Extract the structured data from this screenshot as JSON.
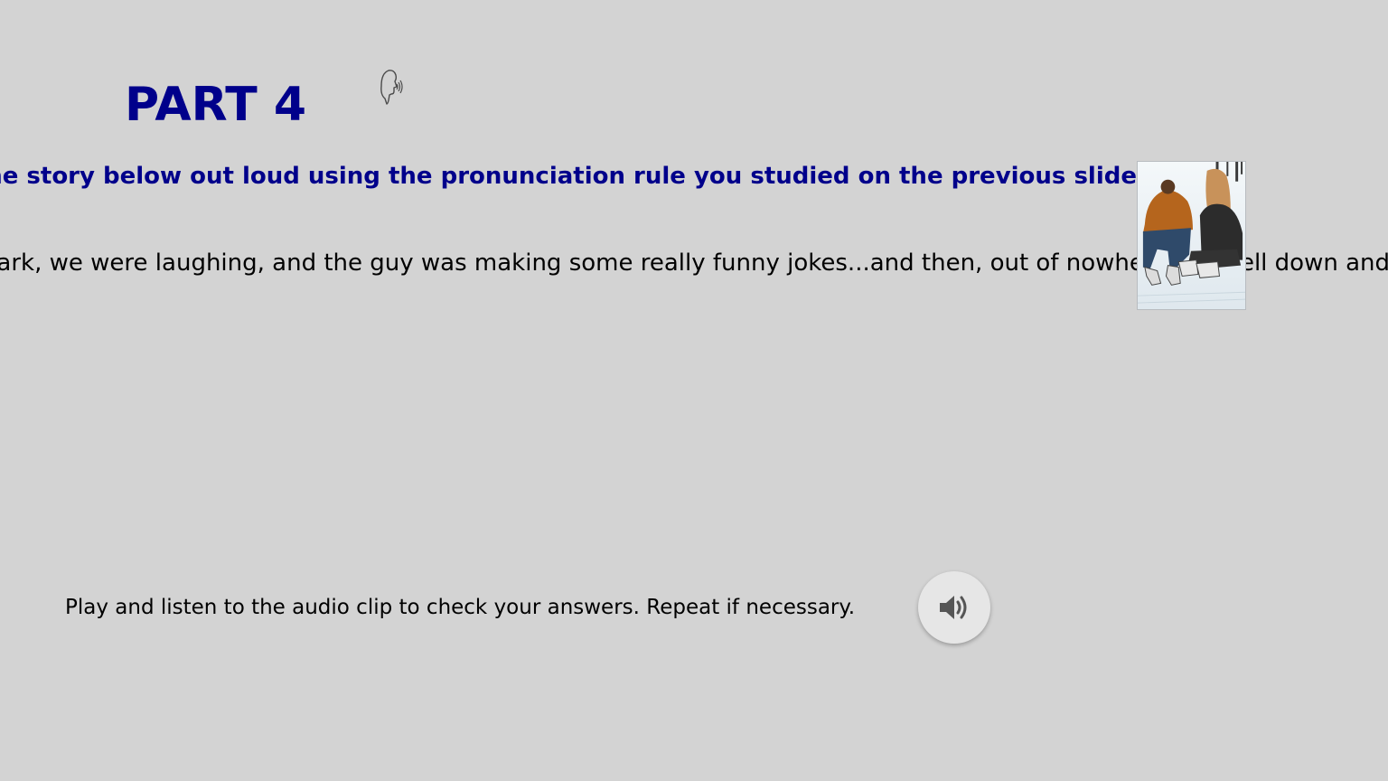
{
  "slide": {
    "title": "PART 4",
    "instruction": "Read the story below out loud using the pronunciation rule you studied on the previous slide",
    "story_text": "We were at the park, we were laughing, and the guy was making some really funny jokes...and then, out of nowhere, she fell down and"
  },
  "audio": {
    "prompt": "Play and listen to the audio clip to check your answers. Repeat if necessary."
  },
  "icons": {
    "speaker_head": "speaker-head-icon",
    "audio_button": "volume-icon",
    "photo": "ice-skating-couple-photo"
  },
  "colors": {
    "background": "#d3d3d3",
    "heading": "#00008b",
    "body_text": "#000000",
    "audio_button": "#e6e6e6",
    "audio_glyph": "#555555"
  }
}
